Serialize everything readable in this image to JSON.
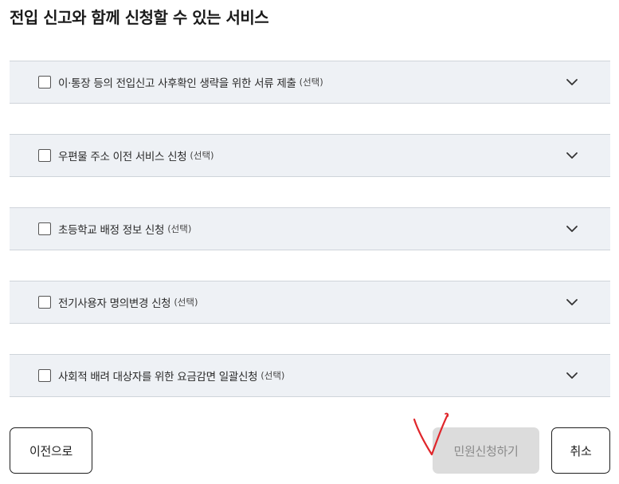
{
  "page": {
    "title": "전입 신고와 함께 신청할 수 있는 서비스"
  },
  "services": [
    {
      "label": "이·통장 등의 전입신고 사후확인 생략을 위한 서류 제출",
      "option": "(선택)",
      "checked": false,
      "expand_icon": "chevron-down-icon"
    },
    {
      "label": "우편물 주소 이전 서비스 신청",
      "option": "(선택)",
      "checked": false,
      "expand_icon": "chevron-down-icon"
    },
    {
      "label": "초등학교 배정 정보 신청",
      "option": "(선택)",
      "checked": false,
      "expand_icon": "chevron-down-icon"
    },
    {
      "label": "전기사용자 명의변경 신청",
      "option": "(선택)",
      "checked": false,
      "expand_icon": "chevron-down-icon"
    },
    {
      "label": "사회적 배려 대상자를 위한 요금감면 일괄신청",
      "option": "(선택)",
      "checked": false,
      "expand_icon": "chevron-down-icon"
    }
  ],
  "buttons": {
    "prev_label": "이전으로",
    "apply_label": "민원신청하기",
    "apply_enabled": false,
    "cancel_label": "취소"
  },
  "annotation": {
    "type": "red-checkmark",
    "color": "#e0262b"
  },
  "colors": {
    "item_background": "#eef1f5",
    "item_border": "#cfd4da",
    "disabled_button": "#dcdcdc",
    "disabled_text": "#8a8a8a"
  }
}
